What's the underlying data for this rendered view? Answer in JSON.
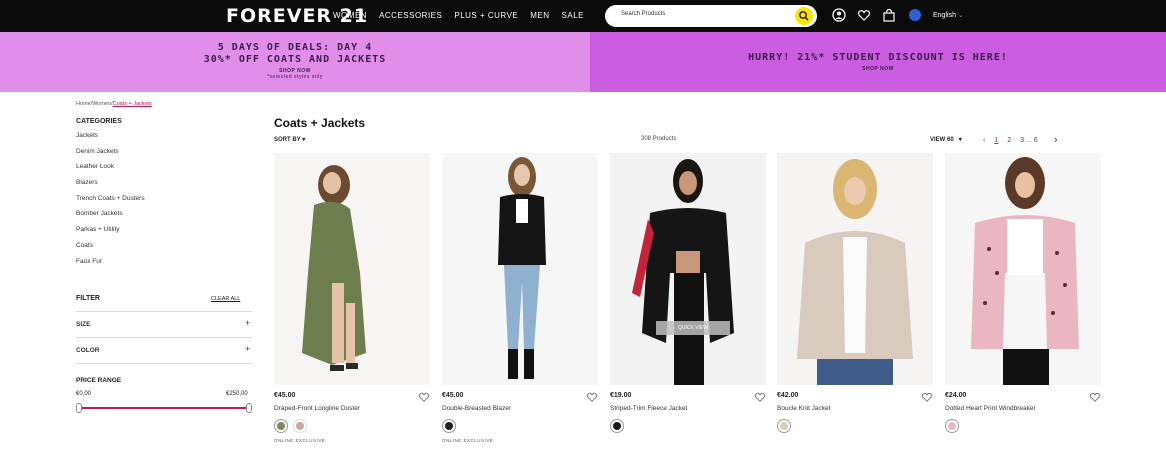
{
  "topnav": {
    "brand": "FOREVER 21",
    "links": [
      "WOMEN",
      "ACCESSORIES",
      "PLUS + CURVE",
      "MEN",
      "SALE"
    ],
    "search_placeholder": "Search Products",
    "language": "English",
    "icons": [
      "search-icon",
      "user-icon",
      "heart-icon",
      "bag-icon",
      "globe-icon",
      "chevron-down-icon"
    ]
  },
  "promos": {
    "left": {
      "line1": "5 DAYS OF DEALS: DAY 4",
      "line2": "30%* OFF COATS AND JACKETS",
      "cta": "SHOP NOW",
      "note": "*selected styles only"
    },
    "right": {
      "line1": "HURRY! 21%* STUDENT DISCOUNT IS HERE!",
      "cta": "SHOP NOW"
    }
  },
  "sidebar": {
    "breadcrumb": {
      "home": "Home",
      "sep": "/",
      "women": "Women",
      "current": "Coats + Jackets"
    },
    "categories_title": "CATEGORIES",
    "categories": [
      "Jackets",
      "Denim Jackets",
      "Leather Look",
      "Blazers",
      "Trench Coats + Dusters",
      "Bomber Jackets",
      "Parkas + Utility",
      "Coats",
      "Faux Fur"
    ],
    "filter_title": "FILTER",
    "clear_all": "CLEAR ALL",
    "facets": [
      {
        "label": "SIZE",
        "toggle": "+"
      },
      {
        "label": "COLOR",
        "toggle": "+"
      }
    ],
    "price_range": {
      "title": "PRICE RANGE",
      "min": "€0,00",
      "max": "€250,00"
    }
  },
  "main": {
    "title": "Coats + Jackets",
    "sort_label": "SORT BY",
    "product_count": "308 Products",
    "view_label": "VIEW 60",
    "pagination": {
      "current": "1",
      "pages": [
        "1",
        "2",
        "3"
      ],
      "ellipsis": "...",
      "last": "6"
    }
  },
  "products": [
    {
      "price": "€45.00",
      "name": "Draped-Front Longline Duster",
      "swatches": [
        "#7d8a5c",
        "#c9a7a0"
      ],
      "badge": "ONLINE EXCLUSIVE"
    },
    {
      "price": "€45.00",
      "name": "Double-Breasted Blazer",
      "swatches": [
        "#222222"
      ],
      "badge": "ONLINE EXCLUSIVE"
    },
    {
      "price": "€19.00",
      "name": "Striped-Trim Fleece Jacket",
      "swatches": [
        "#1a1a1a"
      ],
      "badge": "",
      "overlay": "QUICK VIEW"
    },
    {
      "price": "€42.00",
      "name": "Boucle Knit Jacket",
      "swatches": [
        "#d8cbbd"
      ],
      "badge": ""
    },
    {
      "price": "€24.00",
      "name": "Dotted Heart Print Windbreaker",
      "swatches": [
        "#e8b8c2"
      ],
      "badge": ""
    }
  ],
  "colors": {
    "topbar": "#0b0b0b",
    "promo_left": "#e08ee9",
    "promo_right": "#ca5de0",
    "search_button": "#ffe400",
    "accent": "#b0214c"
  }
}
